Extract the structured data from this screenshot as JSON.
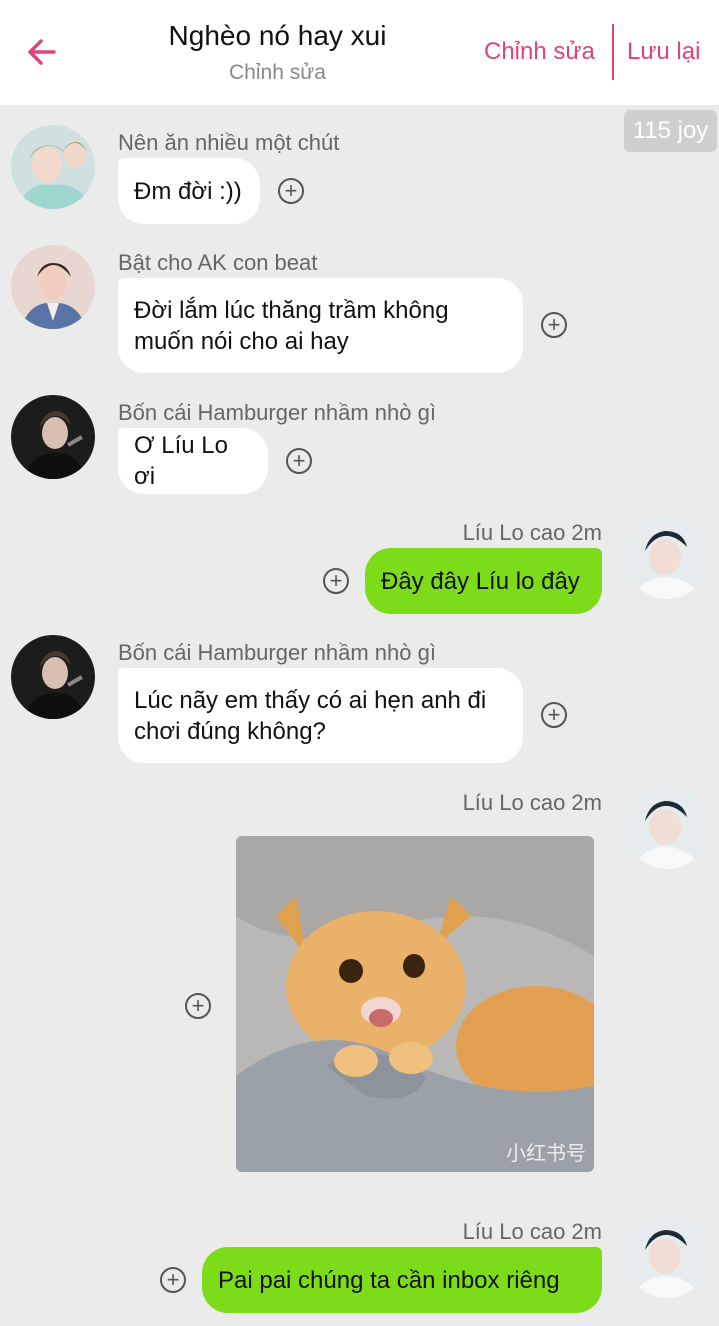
{
  "header": {
    "title": "Nghèo nó hay xui",
    "subtitle": "Chỉnh sửa",
    "edit_label": "Chỉnh sửa",
    "save_label": "Lưu lại"
  },
  "joy_badge": "115 joy",
  "colors": {
    "accent": "#e0437a",
    "outgoing_bubble": "#7cdc1a",
    "incoming_bubble": "#ffffff",
    "background": "#ebebeb"
  },
  "messages": [
    {
      "direction": "incoming",
      "sender": "Nên ăn nhiều một chút",
      "text_lines": [
        "Đm đời :))"
      ]
    },
    {
      "direction": "incoming",
      "sender": "Bật cho AK con beat",
      "text_lines": [
        "Đời lắm lúc thăng trầm không",
        "muốn nói cho ai hay"
      ]
    },
    {
      "direction": "incoming",
      "sender": "Bốn cái Hamburger nhầm nhò gì",
      "text_lines": [
        "Ơ Líu Lo ơi"
      ]
    },
    {
      "direction": "outgoing",
      "sender": "Líu Lo cao 2m",
      "text_lines": [
        "Đây đây Líu lo đây"
      ]
    },
    {
      "direction": "incoming",
      "sender": "Bốn cái Hamburger nhầm nhò gì",
      "text_lines": [
        "Lúc nãy em thấy có ai hẹn anh đi",
        "chơi đúng không?"
      ]
    },
    {
      "direction": "outgoing",
      "sender": "Líu Lo cao 2m",
      "type": "sticker",
      "sticker_watermark": "小红书号"
    },
    {
      "direction": "outgoing",
      "sender": "Líu Lo cao 2m",
      "text_lines": [
        "Pai pai chúng ta cần inbox riêng"
      ]
    }
  ]
}
